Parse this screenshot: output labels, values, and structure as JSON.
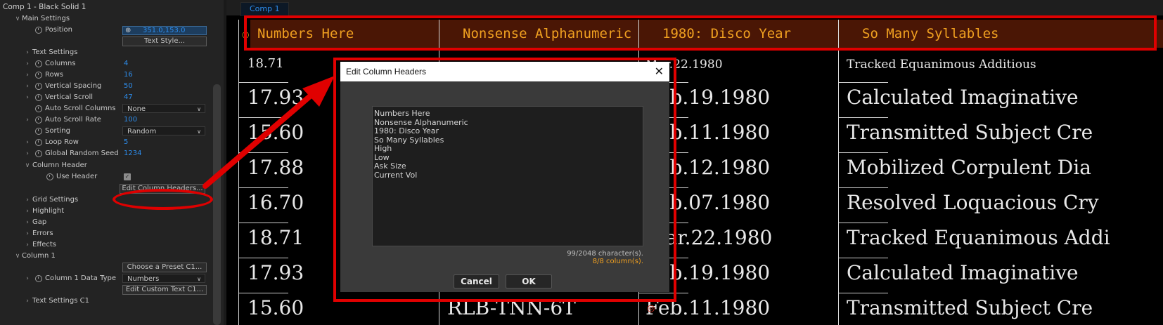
{
  "panel": {
    "title": "Comp 1 - Black Solid 1",
    "main_settings": "Main Settings",
    "position_label": "Position",
    "position_value": "351.0,153.0",
    "text_style_button": "Text Style...",
    "text_settings": "Text Settings",
    "columns_label": "Columns",
    "columns_value": "4",
    "rows_label": "Rows",
    "rows_value": "16",
    "vspacing_label": "Vertical Spacing",
    "vspacing_value": "50",
    "vscroll_label": "Vertical Scroll",
    "vscroll_value": "47",
    "autoscroll_cols_label": "Auto Scroll Columns",
    "autoscroll_cols_value": "None",
    "autoscroll_rate_label": "Auto Scroll Rate",
    "autoscroll_rate_value": "100",
    "sorting_label": "Sorting",
    "sorting_value": "Random",
    "loop_row_label": "Loop Row",
    "loop_row_value": "5",
    "seed_label": "Global Random Seed",
    "seed_value": "1234",
    "column_header": "Column Header",
    "use_header_label": "Use Header",
    "edit_headers_button": "Edit Column Headers...",
    "grid_settings": "Grid Settings",
    "highlight": "Highlight",
    "gap": "Gap",
    "errors": "Errors",
    "effects": "Effects",
    "column1": "Column 1",
    "preset_button": "Choose a Preset C1...",
    "c1_type_label": "Column 1 Data Type",
    "c1_type_value": "Numbers",
    "custom_text_button": "Edit Custom Text C1...",
    "text_settings_c1": "Text Settings C1"
  },
  "viewer": {
    "tab": "Comp 1",
    "headers": [
      "Numbers Here",
      "Nonsense Alphanumeric",
      "1980: Disco Year",
      "So Many Syllables"
    ],
    "col1": [
      "18.71",
      "17.93",
      "15.60",
      "17.88",
      "16.70",
      "18.71",
      "17.93",
      "15.60"
    ],
    "col2_visible": "RLB-TNN-6T",
    "col3": [
      "Mar.22.1980",
      "Feb.19.1980",
      "Feb.11.1980",
      "Feb.12.1980",
      "Feb.07.1980",
      "Mar.22.1980",
      "Feb.19.1980",
      "Feb.11.1980"
    ],
    "col4": [
      "Tracked Equanimous Additious",
      "Calculated Imaginative",
      "Transmitted Subject Cre",
      "Mobilized Corpulent Dia",
      "Resolved Loquacious Cry",
      "Tracked Equanimous Addi",
      "Calculated Imaginative",
      "Transmitted Subject Cre"
    ]
  },
  "dialog": {
    "title": "Edit Column Headers",
    "lines": [
      "Numbers Here",
      "Nonsense Alphanumeric",
      "1980: Disco Year",
      "So Many Syllables",
      "High",
      "Low",
      "Ask Size",
      "Current Vol"
    ],
    "char_count": "99/2048 character(s).",
    "col_count": "8/8 column(s).",
    "cancel": "Cancel",
    "ok": "OK"
  },
  "colors": {
    "accent_blue": "#2d8ceb",
    "header_orange": "#f0a020",
    "annotation_red": "#e00000"
  }
}
